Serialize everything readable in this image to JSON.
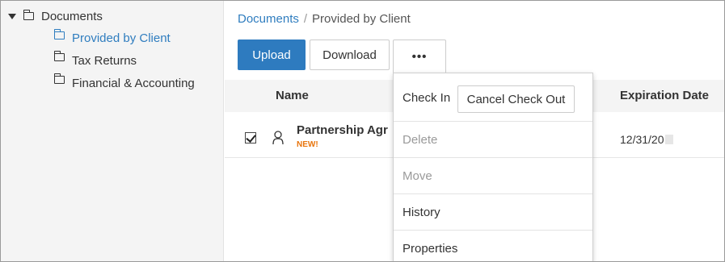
{
  "sidebar": {
    "root": {
      "label": "Documents",
      "icon": "folder-icon"
    },
    "children": [
      {
        "label": "Provided by Client",
        "active": true,
        "icon": "folder-icon"
      },
      {
        "label": "Tax Returns",
        "active": false,
        "icon": "folder-icon"
      },
      {
        "label": "Financial & Accounting",
        "active": false,
        "icon": "folder-icon"
      }
    ]
  },
  "breadcrumb": {
    "root": "Documents",
    "separator": "/",
    "current": "Provided by Client"
  },
  "toolbar": {
    "upload_label": "Upload",
    "download_label": "Download",
    "more_label": "•••"
  },
  "table": {
    "columns": {
      "name": "Name",
      "expiration": "Expiration Date"
    },
    "rows": [
      {
        "name": "Partnership Agr",
        "badge": "NEW!",
        "expiration": "12/31/20",
        "checked": true
      }
    ]
  },
  "menu": {
    "check_in": "Check In",
    "cancel_check_out": "Cancel Check Out",
    "delete": "Delete",
    "move": "Move",
    "history": "History",
    "properties": "Properties"
  },
  "colors": {
    "accent": "#2e7bbf",
    "badge": "#e8740c",
    "disabled": "#9a9a9a"
  }
}
